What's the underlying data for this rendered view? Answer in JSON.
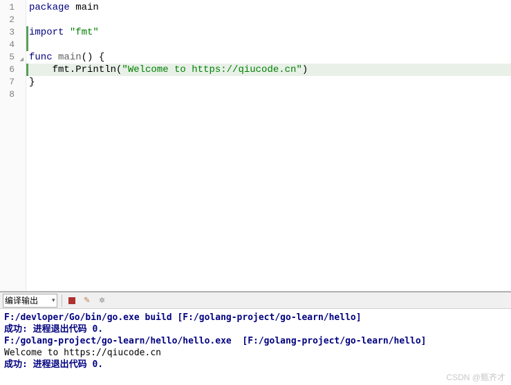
{
  "editor": {
    "lines": [
      {
        "n": "1",
        "changebar": false,
        "fold": "",
        "hl": false,
        "tokens": [
          {
            "t": "kw",
            "v": "package"
          },
          {
            "t": "plain",
            "v": " main"
          }
        ]
      },
      {
        "n": "2",
        "changebar": false,
        "fold": "",
        "hl": false,
        "tokens": []
      },
      {
        "n": "3",
        "changebar": true,
        "fold": "",
        "hl": false,
        "tokens": [
          {
            "t": "kw",
            "v": "import"
          },
          {
            "t": "plain",
            "v": " "
          },
          {
            "t": "str",
            "v": "\"fmt\""
          }
        ]
      },
      {
        "n": "4",
        "changebar": true,
        "fold": "",
        "hl": false,
        "tokens": []
      },
      {
        "n": "5",
        "changebar": false,
        "fold": "◢",
        "hl": false,
        "tokens": [
          {
            "t": "kw",
            "v": "func"
          },
          {
            "t": "plain",
            "v": " "
          },
          {
            "t": "fn",
            "v": "main"
          },
          {
            "t": "plain",
            "v": "() {"
          }
        ]
      },
      {
        "n": "6",
        "changebar": true,
        "fold": "",
        "hl": true,
        "tokens": [
          {
            "t": "plain",
            "v": "    fmt.Println("
          },
          {
            "t": "str",
            "v": "\"Welcome to https://qiucode.cn\""
          },
          {
            "t": "plain",
            "v": ")"
          }
        ]
      },
      {
        "n": "7",
        "changebar": false,
        "fold": "",
        "hl": false,
        "tokens": [
          {
            "t": "plain",
            "v": "}"
          }
        ]
      },
      {
        "n": "8",
        "changebar": false,
        "fold": "",
        "hl": false,
        "tokens": []
      }
    ]
  },
  "toolbar": {
    "dropdown_label": "编译输出"
  },
  "console": {
    "lines": [
      {
        "cls": "cmd",
        "text": "F:/devloper/Go/bin/go.exe build [F:/golang-project/go-learn/hello]"
      },
      {
        "cls": "succ",
        "text": "成功: 进程退出代码 0."
      },
      {
        "cls": "cmd",
        "text": "F:/golang-project/go-learn/hello/hello.exe  [F:/golang-project/go-learn/hello]"
      },
      {
        "cls": "out",
        "text": "Welcome to https://qiucode.cn"
      },
      {
        "cls": "succ",
        "text": "成功: 进程退出代码 0."
      }
    ]
  },
  "watermark": "CSDN @甄齐才"
}
